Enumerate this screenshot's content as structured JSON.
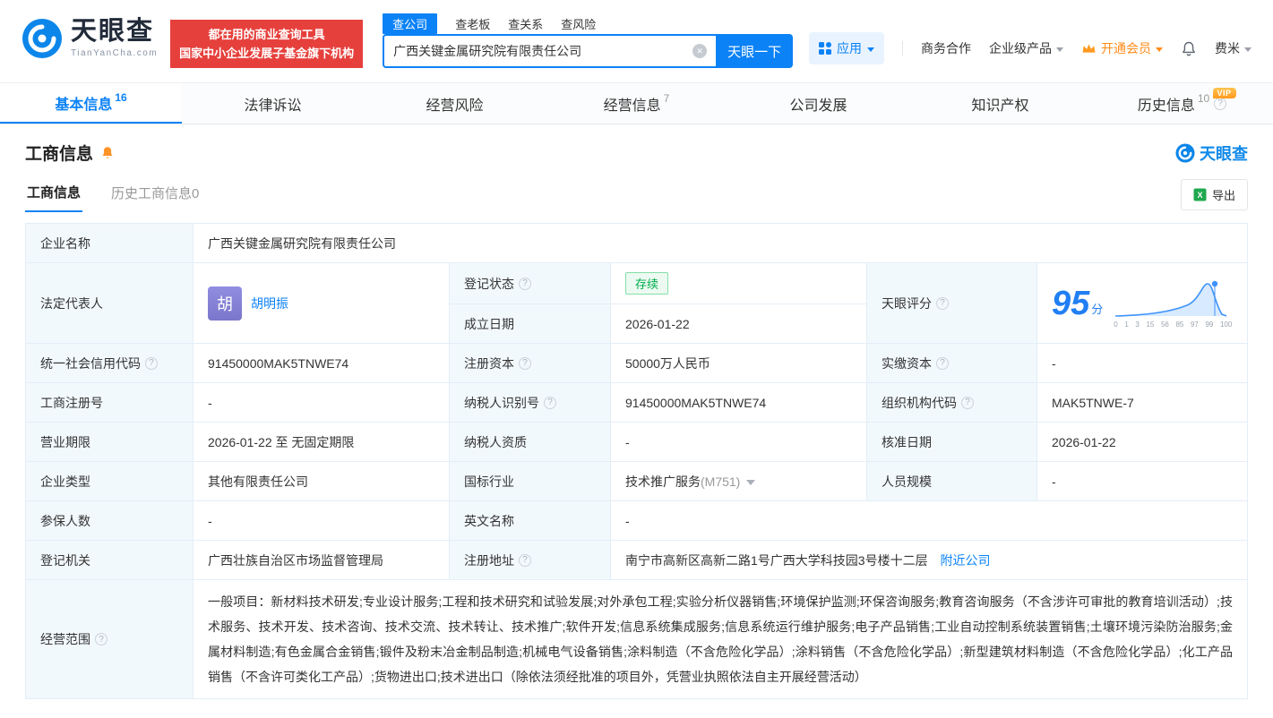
{
  "header": {
    "logo": {
      "name": "天眼查",
      "domain": "TianYanCha.com"
    },
    "slogan": {
      "line1": "都在用的商业查询工具",
      "line2": "国家中小企业发展子基金旗下机构"
    },
    "search": {
      "tabs": [
        {
          "label": "查公司"
        },
        {
          "label": "查老板"
        },
        {
          "label": "查关系"
        },
        {
          "label": "查风险"
        }
      ],
      "value": "广西关键金属研究院有限责任公司",
      "button": "天眼一下"
    },
    "nav": {
      "app": "应用",
      "cooperation": "商务合作",
      "enterprise": "企业级产品",
      "vip": "开通会员",
      "user": "费米"
    }
  },
  "main_tabs": [
    {
      "label": "基本信息",
      "count": "16"
    },
    {
      "label": "法律诉讼",
      "count": ""
    },
    {
      "label": "经营风险",
      "count": ""
    },
    {
      "label": "经营信息",
      "count": "7"
    },
    {
      "label": "公司发展",
      "count": ""
    },
    {
      "label": "知识产权",
      "count": ""
    },
    {
      "label": "历史信息",
      "count": "10",
      "vip_tag": "VIP"
    }
  ],
  "section": {
    "title": "工商信息",
    "brand": "天眼查",
    "subtabs": [
      {
        "label": "工商信息"
      },
      {
        "label": "历史工商信息0"
      }
    ],
    "export": "导出"
  },
  "icons": {
    "help": "?",
    "clear": "✕"
  },
  "info": {
    "company_name": {
      "label": "企业名称",
      "value": "广西关键金属研究院有限责任公司"
    },
    "legal_rep": {
      "label": "法定代表人",
      "avatar": "胡",
      "value": "胡明振"
    },
    "reg_status": {
      "label": "登记状态",
      "value": "存续"
    },
    "est_date": {
      "label": "成立日期",
      "value": "2026-01-22"
    },
    "score": {
      "label": "天眼评分",
      "value": "95",
      "unit": "分",
      "axis": [
        "0",
        "1",
        "3",
        "15",
        "56",
        "85",
        "97",
        "99",
        "100"
      ]
    },
    "credit_code": {
      "label": "统一社会信用代码",
      "value": "91450000MAK5TNWE74"
    },
    "reg_capital": {
      "label": "注册资本",
      "value": "50000万人民币"
    },
    "paid_capital": {
      "label": "实缴资本",
      "value": "-"
    },
    "reg_number": {
      "label": "工商注册号",
      "value": "-"
    },
    "taxpayer_id": {
      "label": "纳税人识别号",
      "value": "91450000MAK5TNWE74"
    },
    "org_code": {
      "label": "组织机构代码",
      "value": "MAK5TNWE-7"
    },
    "business_term": {
      "label": "营业期限",
      "value": "2026-01-22 至 无固定期限"
    },
    "taxpayer_qualification": {
      "label": "纳税人资质",
      "value": "-"
    },
    "approval_date": {
      "label": "核准日期",
      "value": "2026-01-22"
    },
    "company_type": {
      "label": "企业类型",
      "value": "其他有限责任公司"
    },
    "industry": {
      "label": "国标行业",
      "value": "技术推广服务",
      "code": "(M751)"
    },
    "staff_size": {
      "label": "人员规模",
      "value": "-"
    },
    "insured_count": {
      "label": "参保人数",
      "value": "-"
    },
    "english_name": {
      "label": "英文名称",
      "value": "-"
    },
    "reg_authority": {
      "label": "登记机关",
      "value": "广西壮族自治区市场监督管理局"
    },
    "reg_address": {
      "label": "注册地址",
      "value": "南宁市高新区高新二路1号广西大学科技园3号楼十二层",
      "link": "附近公司"
    },
    "business_scope": {
      "label": "经营范围",
      "value": "一般项目：新材料技术研发;专业设计服务;工程和技术研究和试验发展;对外承包工程;实验分析仪器销售;环境保护监测;环保咨询服务;教育咨询服务（不含涉许可审批的教育培训活动）;技术服务、技术开发、技术咨询、技术交流、技术转让、技术推广;软件开发;信息系统集成服务;信息系统运行维护服务;电子产品销售;工业自动控制系统装置销售;土壤环境污染防治服务;金属材料制造;有色金属合金销售;锻件及粉末冶金制品制造;机械电气设备销售;涂料制造（不含危险化学品）;涂料销售（不含危险化学品）;新型建筑材料制造（不含危险化学品）;化工产品销售（不含许可类化工产品）;货物进出口;技术进出口（除依法须经批准的项目外，凭营业执照依法自主开展经营活动）"
    }
  }
}
